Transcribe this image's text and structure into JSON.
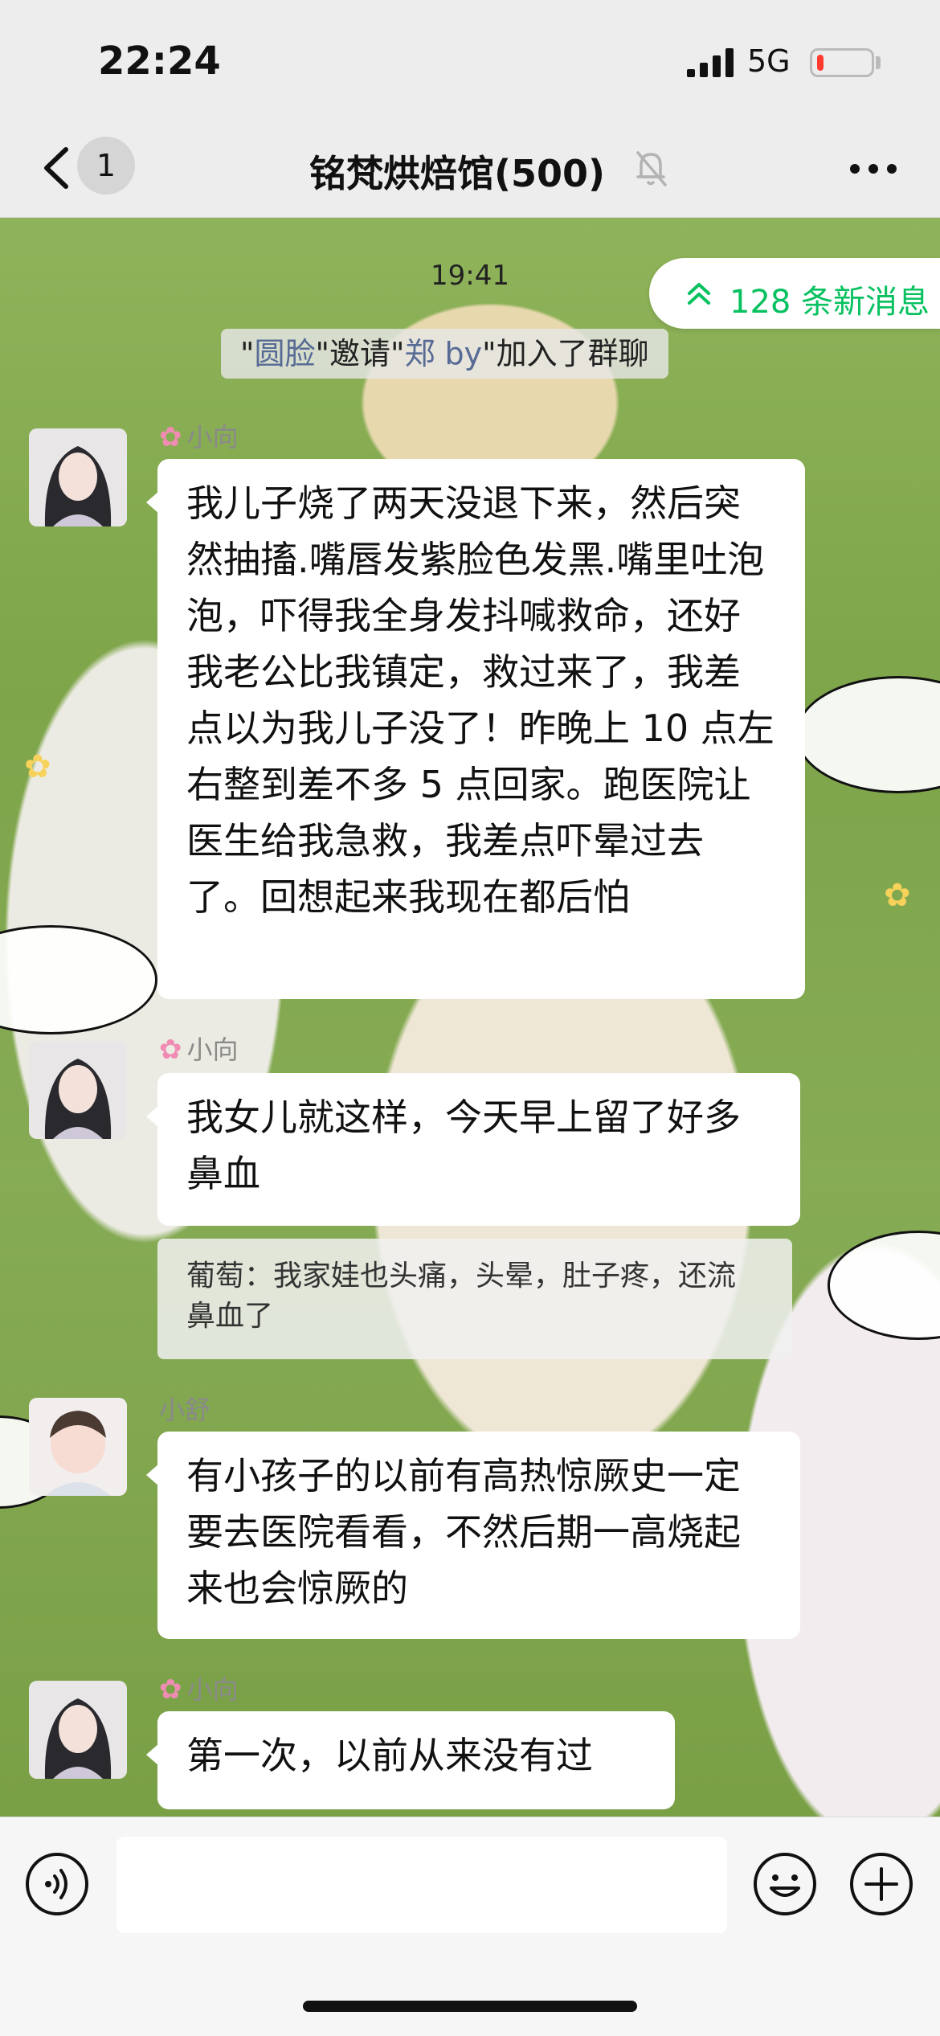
{
  "status_bar": {
    "time": "22:24",
    "network": "5G",
    "battery_level": 0.12,
    "battery_color": "#ff3b30"
  },
  "nav": {
    "back_badge": "1",
    "title": "铭梵烘焙馆(500)",
    "muted": true
  },
  "chat": {
    "timestamp": "19:41",
    "new_messages": "128 条新消息",
    "system_message": {
      "quote_open": "\"",
      "inviter": "圆脸",
      "mid1": "\"邀请\"",
      "invitee": "郑 by",
      "tail": "\"加入了群聊"
    },
    "messages": [
      {
        "sender": "小向",
        "flower": true,
        "text": "我儿子烧了两天没退下来，然后突然抽搐.嘴唇发紫脸色发黑.嘴里吐泡泡，吓得我全身发抖喊救命，还好我老公比我镇定，救过来了，我差点以为我儿子没了！昨晚上 10 点左右整到差不多 5 点回家。跑医院让医生给我急救，我差点吓晕过去了。回想起来我现在都后怕"
      },
      {
        "sender": "小向",
        "flower": true,
        "text": "我女儿就这样，今天早上留了好多鼻血",
        "quote": "葡萄：我家娃也头痛，头晕，肚子疼，还流鼻血了"
      },
      {
        "sender": "小舒",
        "flower": false,
        "text": "有小孩子的以前有高热惊厥史一定要去医院看看，不然后期一高烧起来也会惊厥的"
      },
      {
        "sender": "小向",
        "flower": true,
        "text": "第一次，以前从来没有过"
      }
    ]
  },
  "colors": {
    "accent_green": "#07c160",
    "link_blue": "#576b95",
    "bubble": "#ffffff"
  },
  "icons": {
    "back": "chevron-left-icon",
    "mute": "bell-slash-icon",
    "more": "ellipsis-icon",
    "voice": "voice-icon",
    "emoji": "smiley-icon",
    "plus": "plus-icon",
    "flower": "flower-icon"
  }
}
